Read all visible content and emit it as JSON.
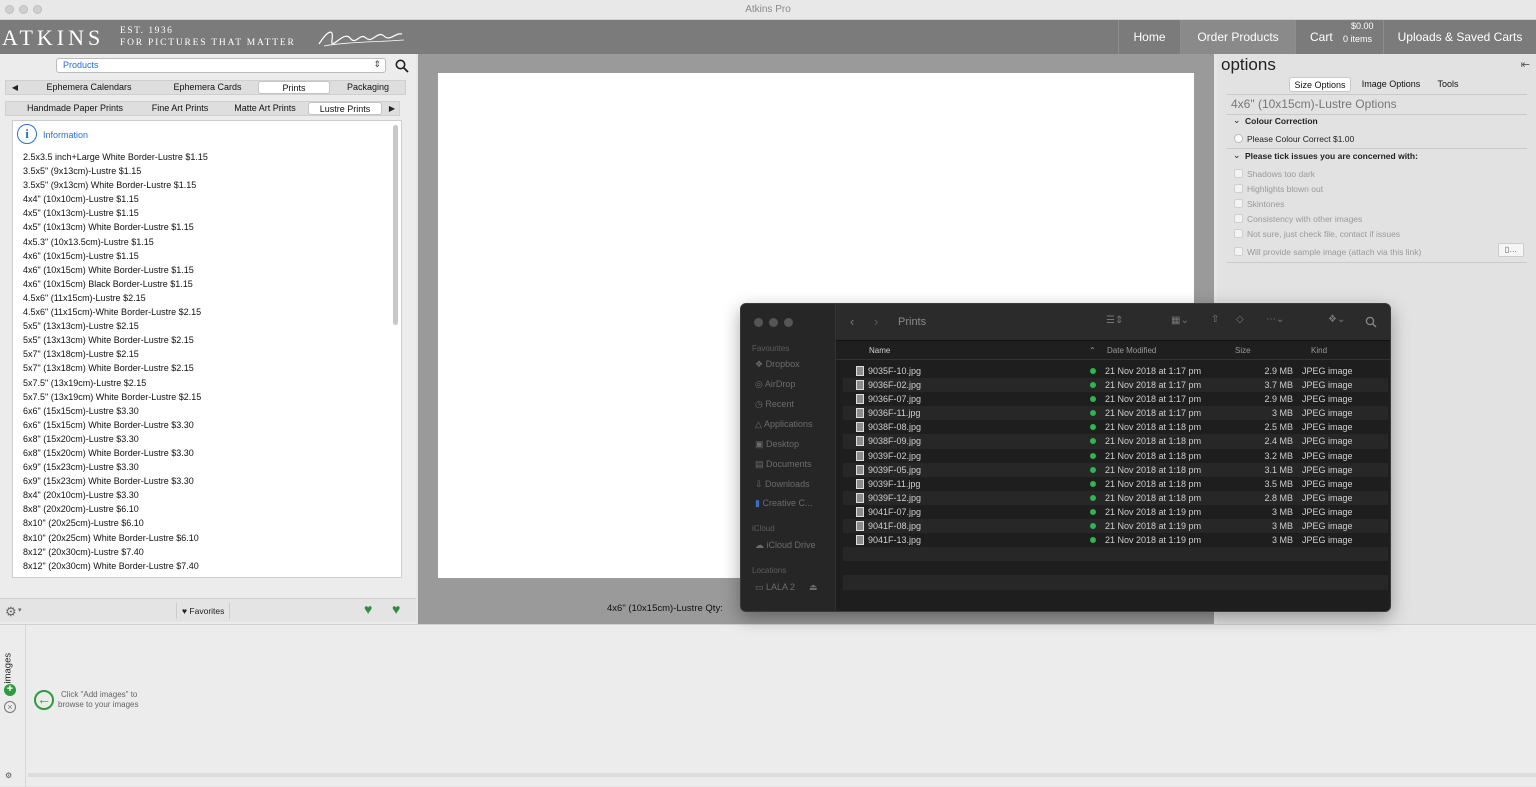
{
  "window": {
    "title": "Atkins Pro"
  },
  "header": {
    "logo": "ATKINS",
    "tagline_line1": "EST. 1936",
    "tagline_line2": "FOR PICTURES THAT MATTER",
    "nav": [
      "Home",
      "Order Products",
      "Cart",
      "Uploads & Saved Carts"
    ],
    "cart_amount": "$0.00",
    "cart_items": "0 items"
  },
  "left": {
    "select_value": "Products",
    "category_tabs": [
      "Ephemera Calendars",
      "Ephemera Cards",
      "Prints",
      "Packaging"
    ],
    "category_selected": "Prints",
    "subtabs": [
      "Handmade Paper Prints",
      "Fine Art Prints",
      "Matte Art Prints",
      "Lustre Prints"
    ],
    "subtab_selected": "Lustre Prints",
    "info_label": "Information",
    "products": [
      "2.5x3.5 inch+Large White Border-Lustre $1.15",
      "3.5x5\" (9x13cm)-Lustre $1.15",
      "3.5x5\" (9x13cm) White Border-Lustre $1.15",
      "4x4\" (10x10cm)-Lustre $1.15",
      "4x5\" (10x13cm)-Lustre $1.15",
      "4x5\" (10x13cm) White Border-Lustre $1.15",
      "4x5.3\" (10x13.5cm)-Lustre $1.15",
      "4x6\" (10x15cm)-Lustre $1.15",
      "4x6\" (10x15cm) White Border-Lustre $1.15",
      "4x6\" (10x15cm) Black Border-Lustre $1.15",
      "4.5x6\" (11x15cm)-Lustre $2.15",
      "4.5x6\" (11x15cm)-White Border-Lustre $2.15",
      "5x5\" (13x13cm)-Lustre $2.15",
      "5x5\" (13x13cm) White Border-Lustre $2.15",
      "5x7\" (13x18cm)-Lustre $2.15",
      "5x7\" (13x18cm) White Border-Lustre $2.15",
      "5x7.5\" (13x19cm)-Lustre $2.15",
      "5x7.5\" (13x19cm) White Border-Lustre $2.15",
      "6x6\" (15x15cm)-Lustre $3.30",
      "6x6\" (15x15cm) White Border-Lustre $3.30",
      "6x8\" (15x20cm)-Lustre $3.30",
      "6x8\" (15x20cm) White Border-Lustre $3.30",
      "6x9\" (15x23cm)-Lustre $3.30",
      "6x9\" (15x23cm) White Border-Lustre $3.30",
      "8x4\" (20x10cm)-Lustre $3.30",
      "8x8\" (20x20cm)-Lustre $6.10",
      "8x10\" (20x25cm)-Lustre $6.10",
      "8x10\" (20x25cm) White Border-Lustre $6.10",
      "8x12\" (20x30cm)-Lustre $7.40",
      "8x12\" (20x30cm) White Border-Lustre $7.40"
    ],
    "favorites_label": "Favorites"
  },
  "center": {
    "qty_label": "4x6\" (10x15cm)-Lustre Qty:"
  },
  "right": {
    "title": "options",
    "tabs": [
      "Size Options",
      "Image Options",
      "Tools"
    ],
    "tab_selected": "Size Options",
    "product_heading": "4x6\" (10x15cm)-Lustre Options",
    "colour_section": "Colour Correction",
    "colour_option": "Please Colour Correct $1.00",
    "issues_section": "Please tick issues you are concerned with:",
    "issues": [
      "Shadows too dark",
      "Highlights blown out",
      "Skintones",
      "Consistency with other images",
      "Not sure, just check file, contact if issues",
      "Will provide sample image (attach via this link)"
    ]
  },
  "bottom": {
    "add_images_label": "Add images",
    "hint_line1": "Click \"Add images\" to",
    "hint_line2": "browse to your images"
  },
  "finder": {
    "title": "Prints",
    "sidebar": {
      "favourites_head": "Favourites",
      "favourites": [
        "Dropbox",
        "AirDrop",
        "Recent",
        "Applications",
        "Desktop",
        "Documents",
        "Downloads",
        "Creative C..."
      ],
      "icloud_head": "iCloud",
      "icloud": [
        "iCloud Drive"
      ],
      "locations_head": "Locations",
      "locations": [
        "LALA 2"
      ]
    },
    "columns": [
      "Name",
      "Date Modified",
      "Size",
      "Kind"
    ],
    "files": [
      {
        "name": "9035F-10.jpg",
        "date": "21 Nov 2018 at 1:17 pm",
        "size": "2.9 MB",
        "kind": "JPEG image"
      },
      {
        "name": "9036F-02.jpg",
        "date": "21 Nov 2018 at 1:17 pm",
        "size": "3.7 MB",
        "kind": "JPEG image"
      },
      {
        "name": "9036F-07.jpg",
        "date": "21 Nov 2018 at 1:17 pm",
        "size": "2.9 MB",
        "kind": "JPEG image"
      },
      {
        "name": "9036F-11.jpg",
        "date": "21 Nov 2018 at 1:17 pm",
        "size": "3 MB",
        "kind": "JPEG image"
      },
      {
        "name": "9038F-08.jpg",
        "date": "21 Nov 2018 at 1:18 pm",
        "size": "2.5 MB",
        "kind": "JPEG image"
      },
      {
        "name": "9038F-09.jpg",
        "date": "21 Nov 2018 at 1:18 pm",
        "size": "2.4 MB",
        "kind": "JPEG image"
      },
      {
        "name": "9039F-02.jpg",
        "date": "21 Nov 2018 at 1:18 pm",
        "size": "3.2 MB",
        "kind": "JPEG image"
      },
      {
        "name": "9039F-05.jpg",
        "date": "21 Nov 2018 at 1:18 pm",
        "size": "3.1 MB",
        "kind": "JPEG image"
      },
      {
        "name": "9039F-11.jpg",
        "date": "21 Nov 2018 at 1:18 pm",
        "size": "3.5 MB",
        "kind": "JPEG image"
      },
      {
        "name": "9039F-12.jpg",
        "date": "21 Nov 2018 at 1:18 pm",
        "size": "2.8 MB",
        "kind": "JPEG image"
      },
      {
        "name": "9041F-07.jpg",
        "date": "21 Nov 2018 at 1:19 pm",
        "size": "3 MB",
        "kind": "JPEG image"
      },
      {
        "name": "9041F-08.jpg",
        "date": "21 Nov 2018 at 1:19 pm",
        "size": "3 MB",
        "kind": "JPEG image"
      },
      {
        "name": "9041F-13.jpg",
        "date": "21 Nov 2018 at 1:19 pm",
        "size": "3 MB",
        "kind": "JPEG image"
      }
    ]
  },
  "colors": {
    "header": "#7b7b7b",
    "accent": "#2b6fd6",
    "synced": "#2fb44f"
  }
}
